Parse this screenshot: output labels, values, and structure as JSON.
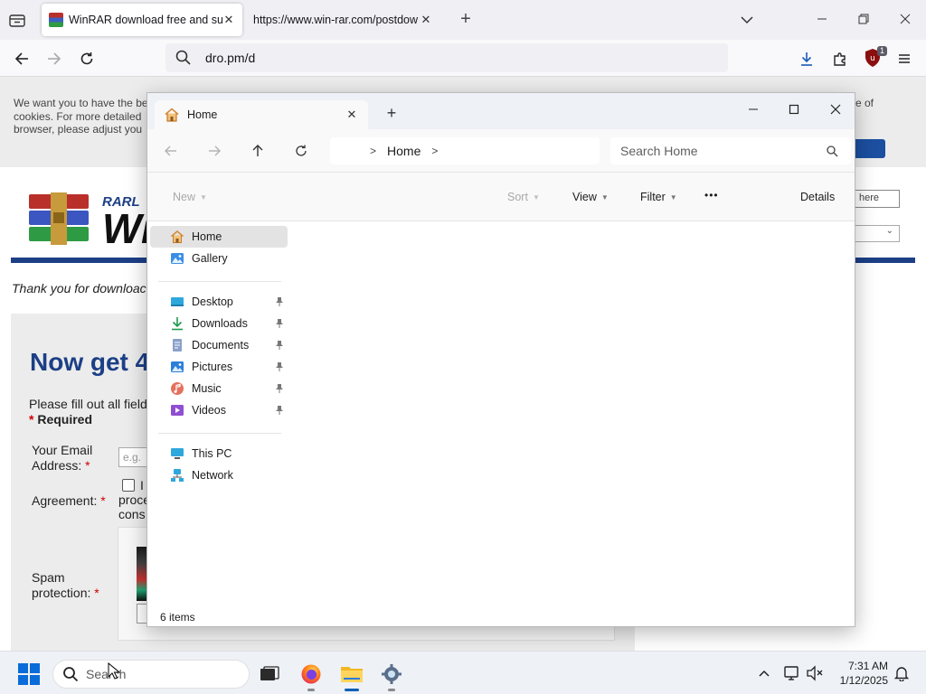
{
  "browser": {
    "tabs": [
      {
        "title": "WinRAR download free and sup",
        "active": true
      },
      {
        "title": "https://www.win-rar.com/postdow",
        "active": false
      }
    ],
    "url": "dro.pm/d",
    "extension_badge": "1"
  },
  "webpage": {
    "cookie_text_lines": [
      "We want you to have the be",
      "cookies. For more detailed",
      "browser, please adjust you"
    ],
    "cookie_text_right": "e of",
    "search_placeholder": "here",
    "logo_small": "RARL",
    "logo_word": "Wi",
    "thank_you": "Thank you for downloac",
    "heading": "Now get 4",
    "fill_out": "Please fill out all field",
    "required_label": "Required",
    "email_label_1": "Your Email",
    "email_label_2": "Address:",
    "email_placeholder": "e.g.",
    "agreement_label": "Agreement:",
    "agreement_text": [
      "I",
      "proce",
      "cons"
    ],
    "spam_label_1": "Spam",
    "spam_label_2": "protection:"
  },
  "explorer": {
    "tab_title": "Home",
    "breadcrumb": [
      "Home"
    ],
    "search_placeholder": "Search Home",
    "commands": {
      "new": "New",
      "sort": "Sort",
      "view": "View",
      "filter": "Filter",
      "more": "•••",
      "details": "Details"
    },
    "sidebar": {
      "top": [
        {
          "label": "Home",
          "icon": "home-icon",
          "selected": true
        },
        {
          "label": "Gallery",
          "icon": "gallery-icon"
        }
      ],
      "pinned": [
        {
          "label": "Desktop",
          "icon": "desktop-icon"
        },
        {
          "label": "Downloads",
          "icon": "downloads-icon"
        },
        {
          "label": "Documents",
          "icon": "documents-icon"
        },
        {
          "label": "Pictures",
          "icon": "pictures-icon"
        },
        {
          "label": "Music",
          "icon": "music-icon"
        },
        {
          "label": "Videos",
          "icon": "videos-icon"
        }
      ],
      "bottom": [
        {
          "label": "This PC",
          "icon": "this-pc-icon"
        },
        {
          "label": "Network",
          "icon": "network-icon"
        }
      ]
    },
    "status": "6 items"
  },
  "taskbar": {
    "search_text": "Search",
    "time": "7:31 AM",
    "date": "1/12/2025",
    "apps": [
      {
        "name": "task-view",
        "icon": "task-view-icon"
      },
      {
        "name": "firefox",
        "icon": "firefox-icon",
        "running": true
      },
      {
        "name": "file-explorer",
        "icon": "folder-icon",
        "running": true,
        "active": true
      },
      {
        "name": "settings",
        "icon": "settings-gear-icon",
        "running": true
      }
    ]
  },
  "colors": {
    "accent": "#005fb8",
    "winrar_blue": "#1c3f86",
    "explorer_selected": "#e3e3e3",
    "chrome_bg": "#f0f0f4"
  }
}
